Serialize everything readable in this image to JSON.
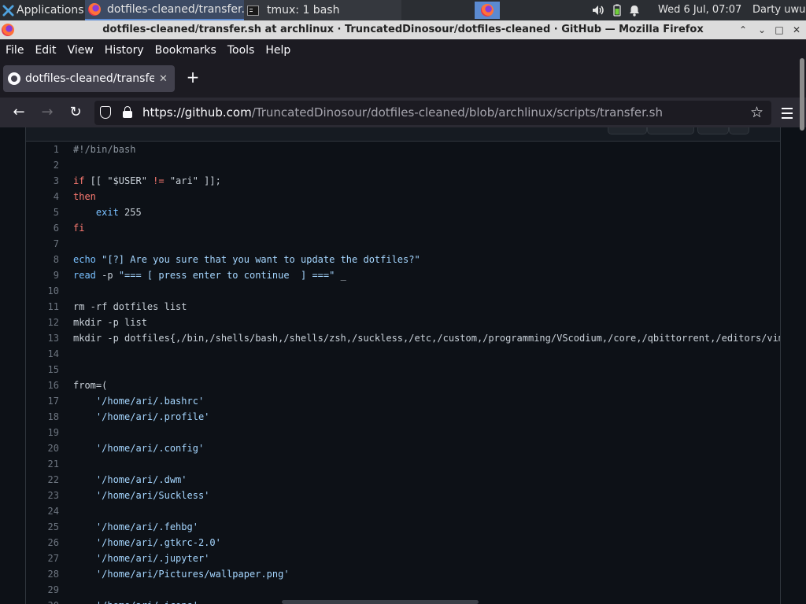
{
  "panel": {
    "applications_label": "Applications",
    "tasks": [
      {
        "label": "dotfiles-cleaned/transfer...",
        "icon": "firefox-icon"
      },
      {
        "label": "tmux: 1 bash",
        "icon": "terminal-icon"
      }
    ],
    "clock": "Wed  6 Jul, 07:07",
    "user": "Darty uwu"
  },
  "window": {
    "title": "dotfiles-cleaned/transfer.sh at archlinux · TruncatedDinosour/dotfiles-cleaned · GitHub — Mozilla Firefox",
    "minimize": "⌃",
    "restore": "⌄",
    "maximize": "□",
    "close": "✕"
  },
  "menubar": {
    "items": [
      "File",
      "Edit",
      "View",
      "History",
      "Bookmarks",
      "Tools",
      "Help"
    ]
  },
  "tabs": {
    "active_label": "dotfiles-cleaned/transfer.sh",
    "close": "✕",
    "new_tab": "+"
  },
  "nav": {
    "back": "←",
    "forward": "→",
    "reload": "↻",
    "url_domain": "https://github.com",
    "url_path": "/TruncatedDinosour/dotfiles-cleaned/blob/archlinux/scripts/transfer.sh",
    "bookmark_star": "☆"
  },
  "code": {
    "lines": [
      {
        "n": "1",
        "parts": [
          {
            "t": "#!/bin/bash",
            "c": "cmt"
          }
        ]
      },
      {
        "n": "2",
        "parts": []
      },
      {
        "n": "3",
        "parts": [
          {
            "t": "if",
            "c": "kw"
          },
          {
            "t": " [[ \"$USER\" "
          },
          {
            "t": "!=",
            "c": "kw"
          },
          {
            "t": " \"ari\" ]];"
          }
        ]
      },
      {
        "n": "4",
        "parts": [
          {
            "t": "then",
            "c": "kw"
          }
        ]
      },
      {
        "n": "5",
        "parts": [
          {
            "t": "    "
          },
          {
            "t": "exit",
            "c": "bi"
          },
          {
            "t": " 255"
          }
        ]
      },
      {
        "n": "6",
        "parts": [
          {
            "t": "fi",
            "c": "kw"
          }
        ]
      },
      {
        "n": "7",
        "parts": []
      },
      {
        "n": "8",
        "parts": [
          {
            "t": "echo",
            "c": "bi"
          },
          {
            "t": " \"[?] Are you sure that you want to update the dotfiles?\"",
            "c": "str"
          }
        ]
      },
      {
        "n": "9",
        "parts": [
          {
            "t": "read",
            "c": "bi"
          },
          {
            "t": " -p "
          },
          {
            "t": "\"=== [ press enter to continue  ] ===\"",
            "c": "str"
          },
          {
            "t": " _"
          }
        ]
      },
      {
        "n": "10",
        "parts": []
      },
      {
        "n": "11",
        "parts": [
          {
            "t": "rm -rf dotfiles list"
          }
        ]
      },
      {
        "n": "12",
        "parts": [
          {
            "t": "mkdir -p list"
          }
        ]
      },
      {
        "n": "13",
        "parts": [
          {
            "t": "mkdir -p dotfiles{,/bin,/shells/bash,/shells/zsh,/suckless,/etc,/custom,/programming/VScodium,/core,/qbittorrent,/editors/vim"
          }
        ]
      },
      {
        "n": "14",
        "parts": []
      },
      {
        "n": "15",
        "parts": []
      },
      {
        "n": "16",
        "parts": [
          {
            "t": "from=("
          }
        ]
      },
      {
        "n": "17",
        "parts": [
          {
            "t": "    "
          },
          {
            "t": "'/home/ari/.bashrc'",
            "c": "str"
          }
        ]
      },
      {
        "n": "18",
        "parts": [
          {
            "t": "    "
          },
          {
            "t": "'/home/ari/.profile'",
            "c": "str"
          }
        ]
      },
      {
        "n": "19",
        "parts": []
      },
      {
        "n": "20",
        "parts": [
          {
            "t": "    "
          },
          {
            "t": "'/home/ari/.config'",
            "c": "str"
          }
        ]
      },
      {
        "n": "21",
        "parts": []
      },
      {
        "n": "22",
        "parts": [
          {
            "t": "    "
          },
          {
            "t": "'/home/ari/.dwm'",
            "c": "str"
          }
        ]
      },
      {
        "n": "23",
        "parts": [
          {
            "t": "    "
          },
          {
            "t": "'/home/ari/Suckless'",
            "c": "str"
          }
        ]
      },
      {
        "n": "24",
        "parts": []
      },
      {
        "n": "25",
        "parts": [
          {
            "t": "    "
          },
          {
            "t": "'/home/ari/.fehbg'",
            "c": "str"
          }
        ]
      },
      {
        "n": "26",
        "parts": [
          {
            "t": "    "
          },
          {
            "t": "'/home/ari/.gtkrc-2.0'",
            "c": "str"
          }
        ]
      },
      {
        "n": "27",
        "parts": [
          {
            "t": "    "
          },
          {
            "t": "'/home/ari/.jupyter'",
            "c": "str"
          }
        ]
      },
      {
        "n": "28",
        "parts": [
          {
            "t": "    "
          },
          {
            "t": "'/home/ari/Pictures/wallpaper.png'",
            "c": "str"
          }
        ]
      },
      {
        "n": "29",
        "parts": []
      },
      {
        "n": "30",
        "parts": [
          {
            "t": "    "
          },
          {
            "t": "'/home/ari/.icons'",
            "c": "str"
          }
        ]
      }
    ]
  },
  "colors": {
    "keyword": "#ff7b72",
    "builtin": "#79c0ff",
    "string": "#a5d6ff",
    "comment": "#8b949e",
    "text": "#c9d1d9",
    "page_bg": "#0d1117"
  }
}
